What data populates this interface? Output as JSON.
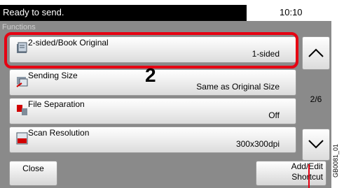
{
  "status": {
    "message": "Ready to send.",
    "time": "10:10"
  },
  "panel": {
    "title": "Functions"
  },
  "items": [
    {
      "label": "2-sided/Book Original",
      "value": "1-sided",
      "icon": "book-original-icon"
    },
    {
      "label": "Sending Size",
      "value": "Same as Original Size",
      "icon": "sending-size-icon"
    },
    {
      "label": "File Separation",
      "value": "Off",
      "icon": "file-separation-icon"
    },
    {
      "label": "Scan Resolution",
      "value": "300x300dpi",
      "icon": "scan-resolution-icon"
    }
  ],
  "pagination": {
    "page": "2/6"
  },
  "buttons": {
    "close": "Close",
    "shortcut_line1": "Add/Edit",
    "shortcut_line2": "Shortcut"
  },
  "callout": {
    "number": "2"
  },
  "figure_id": "GB0081_01",
  "colors": {
    "highlight": "#e60012",
    "panel": "#8a8a8a"
  }
}
